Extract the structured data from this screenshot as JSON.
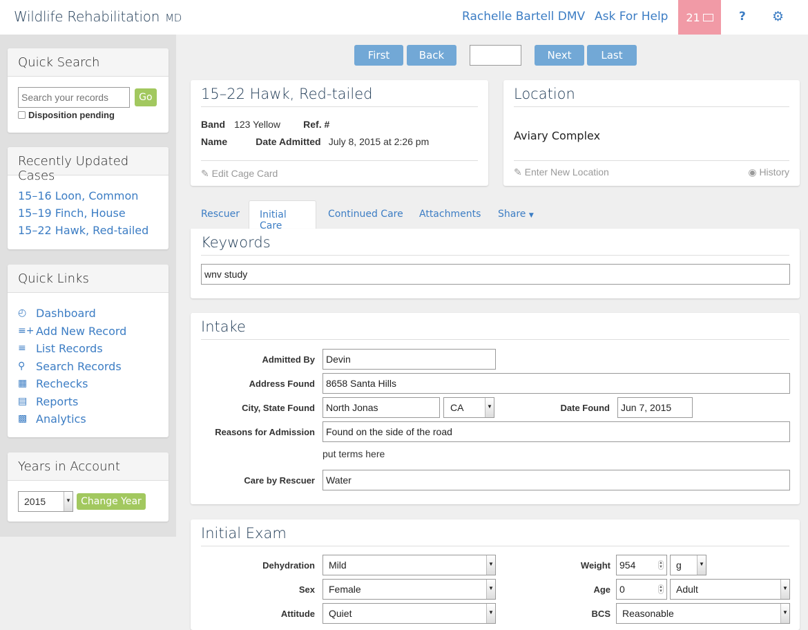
{
  "header": {
    "brand": "Wildlife Rehabilitation",
    "brand_suffix": "MD",
    "user": "Rachelle Bartell DMV",
    "help_link": "Ask For Help",
    "mail_count": "21",
    "question": "?",
    "colors": {
      "link": "#3c7dc4",
      "mail_badge": "#f19aa6"
    }
  },
  "sidebar": {
    "quick_search": {
      "title": "Quick Search",
      "placeholder": "Search your records",
      "go": "Go",
      "checkbox_label": "Disposition pending"
    },
    "recent": {
      "title": "Recently Updated Cases",
      "items": [
        "15–16 Loon, Common",
        "15–19 Finch, House",
        "15–22 Hawk, Red-tailed"
      ]
    },
    "quick_links": {
      "title": "Quick Links",
      "items": [
        {
          "label": "Dashboard",
          "icon": "dashboard-icon"
        },
        {
          "label": "Add New Record",
          "icon": "add-list-icon"
        },
        {
          "label": "List Records",
          "icon": "numbered-list-icon"
        },
        {
          "label": "Search Records",
          "icon": "search-icon"
        },
        {
          "label": "Rechecks",
          "icon": "calendar-icon"
        },
        {
          "label": "Reports",
          "icon": "report-icon"
        },
        {
          "label": "Analytics",
          "icon": "bar-chart-icon"
        }
      ]
    },
    "years": {
      "title": "Years in Account",
      "selected": "2015",
      "button": "Change Year"
    }
  },
  "pager": {
    "first": "First",
    "back": "Back",
    "input": "",
    "next": "Next",
    "last": "Last"
  },
  "record": {
    "title": "15–22 Hawk, Red-tailed",
    "band_label": "Band",
    "band": "123 Yellow",
    "ref_label": "Ref. #",
    "ref": "",
    "name_label": "Name",
    "name": "",
    "date_label": "Date Admitted",
    "date": "July 8, 2015 at 2:26 pm",
    "edit": "Edit Cage Card"
  },
  "location": {
    "title": "Location",
    "value": "Aviary Complex",
    "enter": "Enter New Location",
    "history": "History"
  },
  "tabs": [
    "Rescuer",
    "Initial Care",
    "Continued Care",
    "Attachments",
    "Share"
  ],
  "active_tab": "Initial Care",
  "keywords": {
    "title": "Keywords",
    "value": "wnv study"
  },
  "intake": {
    "title": "Intake",
    "admitted_by_label": "Admitted By",
    "admitted_by": "Devin",
    "address_label": "Address Found",
    "address": "8658 Santa Hills",
    "city_label": "City, State Found",
    "city": "North Jonas",
    "state": "CA",
    "date_found_label": "Date Found",
    "date_found": "Jun 7, 2015",
    "reasons_label": "Reasons for Admission",
    "reasons": "Found on the side of the road",
    "terms_hint": "put terms here",
    "care_label": "Care by Rescuer",
    "care": "Water"
  },
  "exam": {
    "title": "Initial Exam",
    "dehydration_label": "Dehydration",
    "dehydration": "Mild",
    "sex_label": "Sex",
    "sex": "Female",
    "attitude_label": "Attitude",
    "attitude": "Quiet",
    "weight_label": "Weight",
    "weight": "954",
    "weight_unit": "g",
    "age_label": "Age",
    "age": "0",
    "age_unit": "Adult",
    "bcs_label": "BCS",
    "bcs": "Reasonable"
  }
}
